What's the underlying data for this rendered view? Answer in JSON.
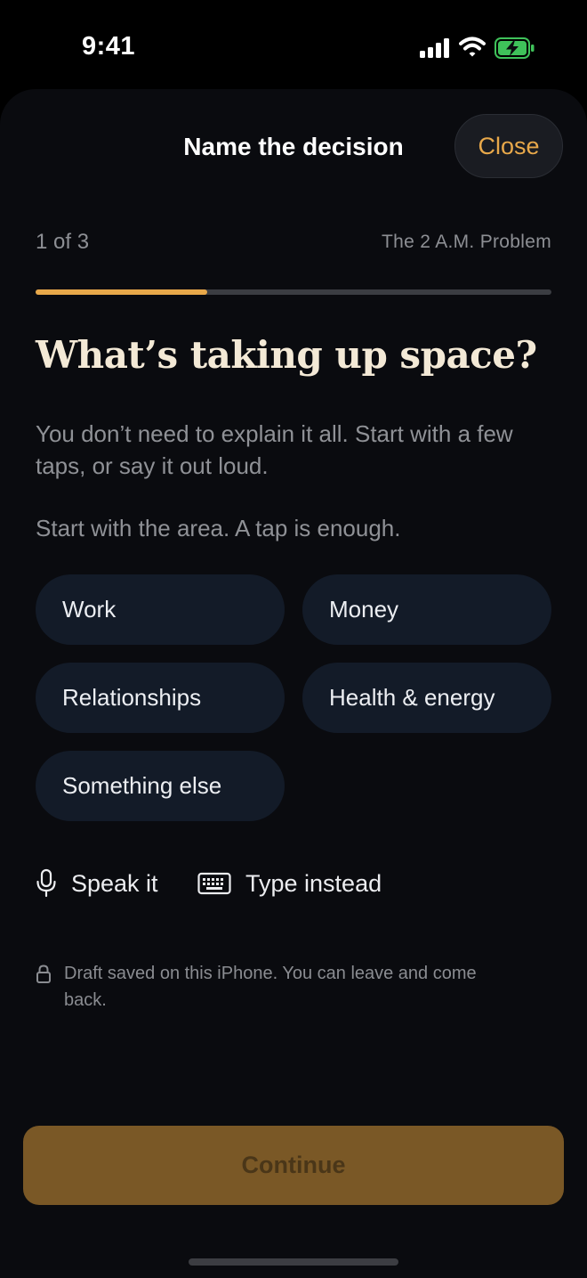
{
  "status_bar": {
    "time": "9:41",
    "signal_icon": "cellular-signal-icon",
    "wifi_icon": "wifi-icon",
    "battery_icon": "battery-charging-icon"
  },
  "header": {
    "title": "Name the decision",
    "close_label": "Close"
  },
  "progress": {
    "step_label": "1 of 3",
    "caption": "The 2 A.M. Problem",
    "fraction": 0.333
  },
  "content": {
    "headline": "What’s taking up space?",
    "subtext": "You don’t need to explain it all. Start with a few taps, or say it out loud.",
    "area_prompt": "Start with the area. A tap is enough."
  },
  "areas": [
    {
      "label": "Work"
    },
    {
      "label": "Money"
    },
    {
      "label": "Relationships"
    },
    {
      "label": "Health & energy"
    },
    {
      "label": "Something else"
    }
  ],
  "input_actions": {
    "speak_label": "Speak it",
    "speak_icon": "microphone-icon",
    "type_label": "Type instead",
    "type_icon": "keyboard-icon"
  },
  "draft_note": {
    "icon": "lock-icon",
    "text": "Draft saved on this iPhone. You can leave and come back."
  },
  "footer": {
    "continue_label": "Continue"
  },
  "colors": {
    "accent": "#e8a84a",
    "background": "#0a0b0f",
    "chip": "#131b28",
    "continue_disabled": "#7a5826",
    "headline": "#f3e9d6"
  }
}
